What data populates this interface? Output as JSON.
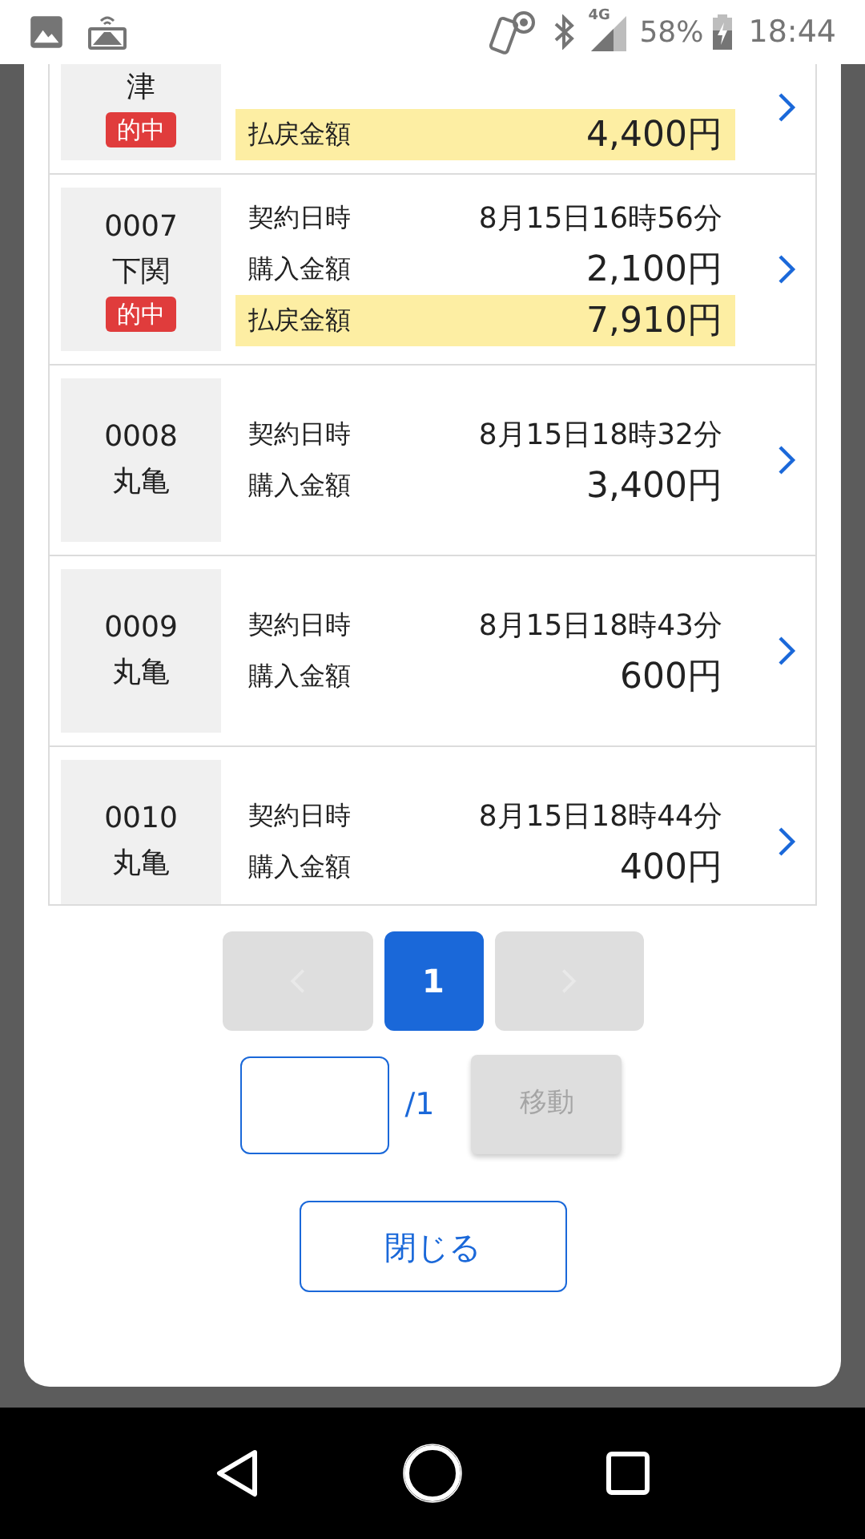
{
  "status_bar": {
    "network": "4G",
    "battery": "58%",
    "time": "18:44"
  },
  "tickets": [
    {
      "venue": "津",
      "badge": "的中",
      "payout": {
        "label": "払戻金額",
        "value": "4,400円"
      }
    },
    {
      "number": "0007",
      "venue": "下関",
      "badge": "的中",
      "fields": [
        {
          "label": "契約日時",
          "value": "8月15日16時56分"
        },
        {
          "label": "購入金額",
          "value": "2,100円"
        }
      ],
      "payout": {
        "label": "払戻金額",
        "value": "7,910円"
      }
    },
    {
      "number": "0008",
      "venue": "丸亀",
      "fields": [
        {
          "label": "契約日時",
          "value": "8月15日18時32分"
        },
        {
          "label": "購入金額",
          "value": "3,400円"
        }
      ]
    },
    {
      "number": "0009",
      "venue": "丸亀",
      "fields": [
        {
          "label": "契約日時",
          "value": "8月15日18時43分"
        },
        {
          "label": "購入金額",
          "value": "600円"
        }
      ]
    },
    {
      "number": "0010",
      "venue": "丸亀",
      "fields": [
        {
          "label": "契約日時",
          "value": "8月15日18時44分"
        },
        {
          "label": "購入金額",
          "value": "400円"
        }
      ]
    }
  ],
  "pagination": {
    "prev_disabled": true,
    "next_disabled": true,
    "pages": [
      {
        "label": "1",
        "selected": true
      }
    ]
  },
  "page_jump": {
    "total": "/1",
    "button": "移動",
    "disabled": true
  },
  "close_button": "閉じる"
}
